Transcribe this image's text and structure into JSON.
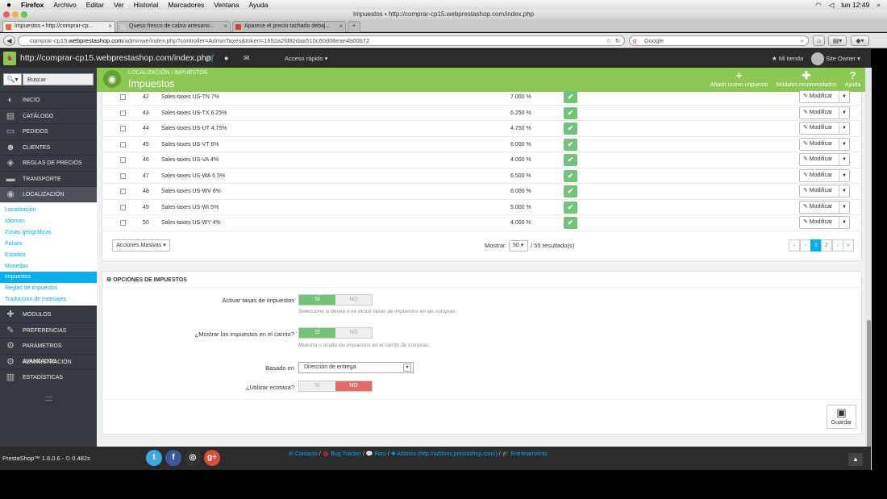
{
  "macbar": {
    "apple": "",
    "app": "Firefox",
    "menus": [
      "Archivo",
      "Editar",
      "Ver",
      "Historial",
      "Marcadores",
      "Ventana",
      "Ayuda"
    ],
    "clock": "lun 12:49"
  },
  "window": {
    "title": "Impuestos • http://comprar-cp15.webprestashop.com/index.php"
  },
  "tabs": [
    {
      "label": "Impuestos • http://comprar-cp...",
      "fav": "#e46e2a"
    },
    {
      "label": "Queso fresco de cabra artesano...",
      "fav": "#cccccc"
    },
    {
      "label": "Aparece el precio tachado debaj...",
      "fav": "#d04040"
    }
  ],
  "tab_new": "+",
  "nav": {
    "url_prefix": "comprar-cp15.",
    "url_domain": "webprestashop.com",
    "url_rest": "/adminwe/index.php?controller=AdminTaxes&token=1692a2fd82daa510c60d08eae4b00b72",
    "search_placeholder": "Google"
  },
  "header": {
    "url": "http://comprar-cp15.webprestashop.com/index.php",
    "quick": "Acceso rápido ▾",
    "shop": "Mi tienda",
    "owner": "Site Owner ▾"
  },
  "sidebar": {
    "search_icon": "🔍▾",
    "search_placeholder": "Buscar",
    "menu_top": [
      {
        "label": "Inicio",
        "icon": "speedometer-icon",
        "glyph": "◐"
      },
      {
        "label": "Catálogo",
        "icon": "book-icon",
        "glyph": "▤"
      },
      {
        "label": "Pedidos",
        "icon": "credit-card-icon",
        "glyph": "▭"
      },
      {
        "label": "Clientes",
        "icon": "users-icon",
        "glyph": "☻"
      },
      {
        "label": "Reglas de precios",
        "icon": "tags-icon",
        "glyph": "◈"
      },
      {
        "label": "Transporte",
        "icon": "truck-icon",
        "glyph": "▬"
      },
      {
        "label": "Localización",
        "icon": "globe-icon",
        "glyph": "◉"
      }
    ],
    "submenu": [
      "Localización",
      "Idiomas",
      "Zonas geográficas",
      "Países",
      "Estados",
      "Monedas",
      "Impuestos",
      "Reglas de impuestos",
      "Traducción de mensajes"
    ],
    "submenu_active": 6,
    "menu_bottom": [
      {
        "label": "Módulos",
        "icon": "puzzle-icon",
        "glyph": "✚"
      },
      {
        "label": "Preferencias",
        "icon": "wrench-icon",
        "glyph": "✎"
      },
      {
        "label": "Parámetros avanzados",
        "icon": "cogs-icon",
        "glyph": "⚙"
      },
      {
        "label": "Administración",
        "icon": "cog-icon",
        "glyph": "⚙"
      },
      {
        "label": "Estadísticas",
        "icon": "bar-chart-icon",
        "glyph": "▥"
      }
    ]
  },
  "page": {
    "breadcrumb": [
      "Localización",
      "Impuestos"
    ],
    "breadcrumb_sep": "/",
    "title": "Impuestos",
    "toolbar": [
      {
        "label": "Añadir nuevo impuesto",
        "glyph": "+",
        "icon": "add-icon"
      },
      {
        "label": "Módulos recomendados",
        "glyph": "✚",
        "icon": "puzzle-icon"
      },
      {
        "label": "Ayuda",
        "glyph": "?",
        "icon": "help-icon"
      }
    ]
  },
  "table": {
    "rows": [
      {
        "id": "42",
        "name": "Sales-taxes US-TN 7%",
        "rate": "7.000 %"
      },
      {
        "id": "43",
        "name": "Sales-taxes US-TX 6.25%",
        "rate": "6.250 %"
      },
      {
        "id": "44",
        "name": "Sales-taxes US-UT 4.75%",
        "rate": "4.750 %"
      },
      {
        "id": "45",
        "name": "Sales-taxes US-VT 6%",
        "rate": "6.000 %"
      },
      {
        "id": "46",
        "name": "Sales-taxes US-VA 4%",
        "rate": "4.000 %"
      },
      {
        "id": "47",
        "name": "Sales-taxes US-WA 6.5%",
        "rate": "6.500 %"
      },
      {
        "id": "48",
        "name": "Sales-taxes US-WV 6%",
        "rate": "6.000 %"
      },
      {
        "id": "49",
        "name": "Sales-taxes US-WI 5%",
        "rate": "5.000 %"
      },
      {
        "id": "50",
        "name": "Sales-taxes US-WY 4%",
        "rate": "4.000 %"
      }
    ],
    "enabled_glyph": "✔",
    "modify_label": "✎ Modificar",
    "caret": "▼",
    "bulk": "Acciones Masivas ▾",
    "show_label": "Mostrar:",
    "per_page": "50 ▾",
    "results": "/ 55 resultado(s)",
    "pagination": [
      "«",
      "‹",
      "1",
      "2",
      "›",
      "»"
    ],
    "current_page": 2
  },
  "options": {
    "heading": "Opciones de impuestos",
    "heading_glyph": "⚙",
    "activar": {
      "label": "Activar tasas de impuestos",
      "yes": "SÍ",
      "no": "NO",
      "help": "Seleccione si desea o no incluir tasas de impuestos en las compras."
    },
    "mostrar": {
      "label": "¿Mostrar los impuestos en el carrito?",
      "yes": "SÍ",
      "no": "NO",
      "help": "Muestra u oculta los impuestos en el carrito de compras."
    },
    "basado": {
      "label": "Basado en",
      "value": "Dirección de entrega",
      "arrow": "▾"
    },
    "ecotasa": {
      "label": "¿Utilizar ecotasa?",
      "yes": "SÍ",
      "no": "NO"
    },
    "save": "Guardar",
    "save_glyph": "▣"
  },
  "footer": {
    "version": "PrestaShop™ 1.6.0.6 - ⏲ 0.482s",
    "social": [
      {
        "glyph": "t",
        "color": "#3fa9df",
        "icon": "twitter-icon"
      },
      {
        "glyph": "f",
        "color": "#3b5998",
        "icon": "facebook-icon"
      },
      {
        "glyph": "◎",
        "color": "#333333",
        "icon": "github-icon"
      },
      {
        "glyph": "g+",
        "color": "#dd4b39",
        "icon": "google-plus-icon"
      }
    ],
    "links": [
      "✉ Contacto",
      "🐞 Bug Tracker",
      "💬 Foro",
      "✚ Addons (http://addons.prestashop.com/)",
      "🎓 Entrenamiento"
    ],
    "link_sep": " / ",
    "to_top": "▲"
  },
  "colors": {
    "green": "#8bc954",
    "blue": "#00aff0",
    "sidebar": "#363a41",
    "red": "#e06b68"
  }
}
